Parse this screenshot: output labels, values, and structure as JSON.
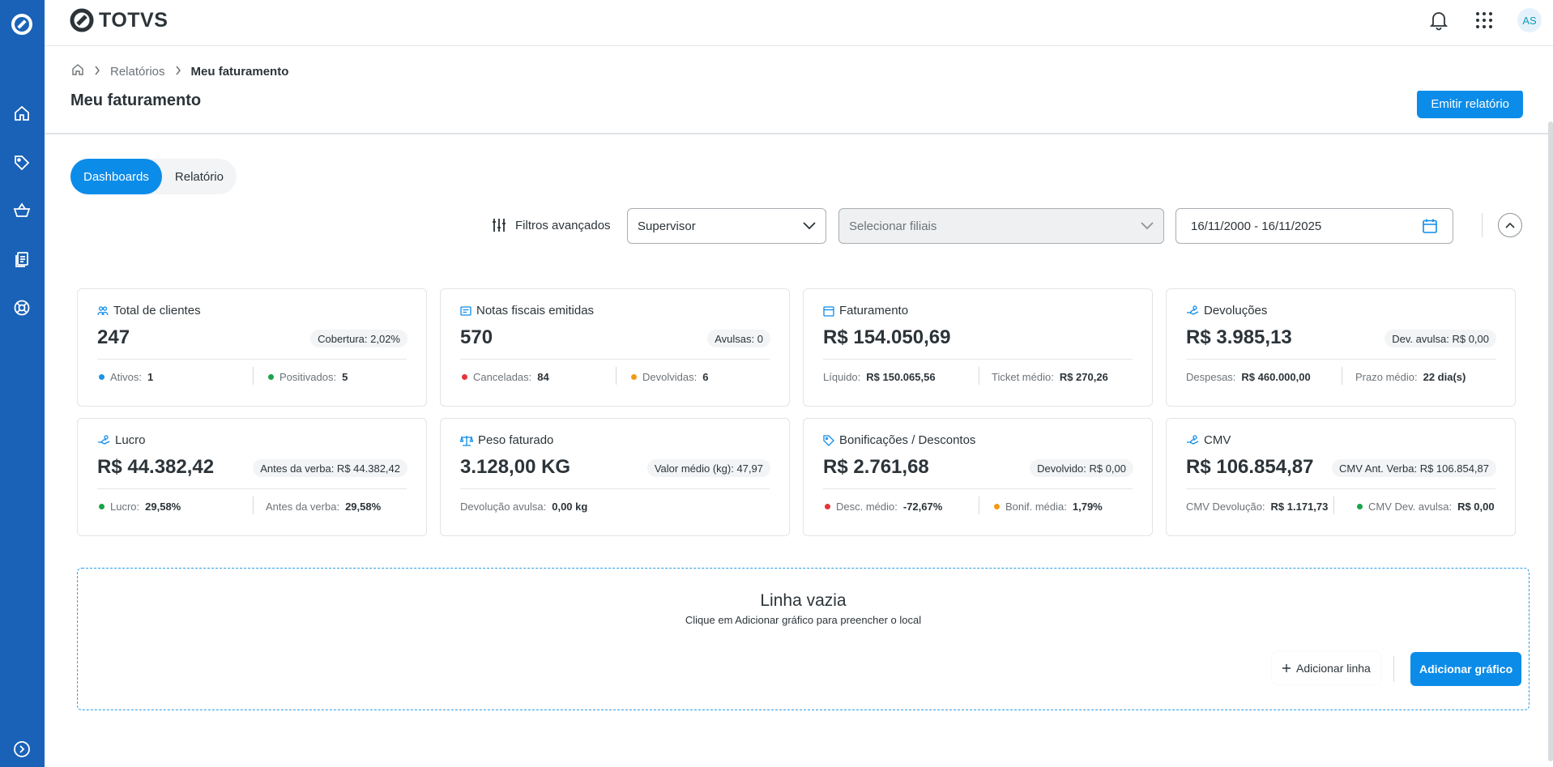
{
  "brand": {
    "name": "TOTVS"
  },
  "header": {
    "avatar_initials": "AS"
  },
  "breadcrumb": {
    "level1": "Relatórios",
    "current": "Meu faturamento"
  },
  "page": {
    "title": "Meu faturamento",
    "emit_button": "Emitir relatório"
  },
  "tabs": [
    {
      "label": "Dashboards",
      "active": true
    },
    {
      "label": "Relatório",
      "active": false
    }
  ],
  "filters": {
    "advanced_label": "Filtros avançados",
    "supervisor_value": "Supervisor",
    "branch_placeholder": "Selecionar filiais",
    "date_range": "16/11/2000 - 16/11/2025"
  },
  "cards": [
    {
      "title": "Total de clientes",
      "icon": "users-icon",
      "value": "247",
      "badge": "Cobertura: 2,02%",
      "foot": [
        {
          "dot": "#1b94e4",
          "label": "Ativos:",
          "value": "1"
        },
        {
          "dot": "#1aa34a",
          "label": "Positivados:",
          "value": "5"
        }
      ]
    },
    {
      "title": "Notas fiscais emitidas",
      "icon": "receipt-icon",
      "value": "570",
      "badge": "Avulsas: 0",
      "foot": [
        {
          "dot": "#e5353b",
          "label": "Canceladas:",
          "value": "84"
        },
        {
          "dot": "#f09b15",
          "label": "Devolvidas:",
          "value": "6"
        }
      ]
    },
    {
      "title": "Faturamento",
      "icon": "calendar-icon",
      "value": "R$ 154.050,69",
      "badge": "",
      "foot": [
        {
          "dot": "",
          "label": "Líquido:",
          "value": "R$ 150.065,56"
        },
        {
          "dot": "",
          "label": "Ticket médio:",
          "value": "R$ 270,26"
        }
      ]
    },
    {
      "title": "Devoluções",
      "icon": "hand-money-icon",
      "value": "R$ 3.985,13",
      "badge": "Dev. avulsa: R$ 0,00",
      "foot": [
        {
          "dot": "",
          "label": "Despesas:",
          "value": "R$ 460.000,00"
        },
        {
          "dot": "",
          "label": "Prazo médio:",
          "value": "22 dia(s)"
        }
      ]
    },
    {
      "title": "Lucro",
      "icon": "hand-money-icon",
      "value": "R$ 44.382,42",
      "badge": "Antes da verba: R$ 44.382,42",
      "foot": [
        {
          "dot": "#1aa34a",
          "label": "Lucro:",
          "value": "29,58%"
        },
        {
          "dot": "",
          "label": "Antes da verba:",
          "value": "29,58%"
        }
      ]
    },
    {
      "title": "Peso faturado",
      "icon": "scale-icon",
      "value": "3.128,00 KG",
      "badge": "Valor médio (kg): 47,97",
      "foot": [
        {
          "dot": "",
          "label": "Devolução avulsa:",
          "value": "0,00 kg"
        }
      ]
    },
    {
      "title": "Bonificações / Descontos",
      "icon": "tag-icon",
      "value": "R$ 2.761,68",
      "badge": "Devolvido: R$ 0,00",
      "foot": [
        {
          "dot": "#e5353b",
          "label": "Desc. médio:",
          "value": "-72,67%"
        },
        {
          "dot": "#f09b15",
          "label": "Bonif. média:",
          "value": "1,79%"
        }
      ]
    },
    {
      "title": "CMV",
      "icon": "hand-money-icon",
      "value": "R$ 106.854,87",
      "badge": "CMV Ant. Verba: R$ 106.854,87",
      "foot": [
        {
          "dot": "",
          "label": "CMV Devolução:",
          "value": "R$ 1.171,73"
        },
        {
          "dot": "#1aa34a",
          "label": "CMV Dev. avulsa:",
          "value": "R$ 0,00"
        }
      ]
    }
  ],
  "empty_row": {
    "title": "Linha vazia",
    "subtitle": "Clique em Adicionar gráfico para preencher o local",
    "add_line": "Adicionar linha",
    "add_chart": "Adicionar gráfico"
  }
}
